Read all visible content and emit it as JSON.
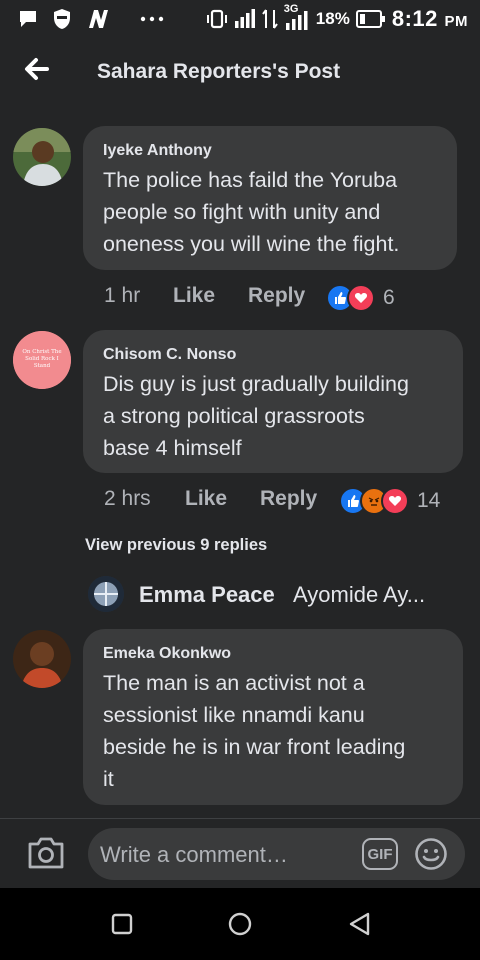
{
  "status_bar": {
    "battery_pct": "18%",
    "time": "8:12",
    "ampm": "PM",
    "network": "3G"
  },
  "header": {
    "title": "Sahara Reporters's Post"
  },
  "comments": [
    {
      "author": "Iyeke Anthony",
      "text": "The police has faild the Yoruba\npeople so fight with unity and\noneness you will wine the fight.",
      "time": "1 hr",
      "like_label": "Like",
      "reply_label": "Reply",
      "reaction_count": "6",
      "reactions": [
        "like",
        "love"
      ]
    },
    {
      "author": "Chisom C. Nonso",
      "avatar_text": "On Christ The Solid Rock I Stand",
      "text": "Dis guy is just gradually building\na strong political grassroots\nbase 4 himself",
      "time": "2 hrs",
      "like_label": "Like",
      "reply_label": "Reply",
      "reaction_count": "14",
      "reactions": [
        "like",
        "angry",
        "love"
      ]
    },
    {
      "author": "Emeka Okonkwo",
      "text": "The man is an activist not a\nsessionist like nnamdi  kanu\nbeside he is in war front leading\nit"
    }
  ],
  "view_previous": "View previous 9 replies",
  "latest_reply": {
    "author": "Emma Peace",
    "snippet": "Ayomide Ay..."
  },
  "composer": {
    "placeholder": "Write a comment…",
    "gif_label": "GIF"
  },
  "colors": {
    "background": "#242526",
    "bubble": "#3a3b3c",
    "text": "#e4e6eb",
    "muted": "#b0b3b8",
    "like_blue": "#1877f2",
    "love_red": "#f33e58",
    "angry_orange": "#e9710f"
  }
}
